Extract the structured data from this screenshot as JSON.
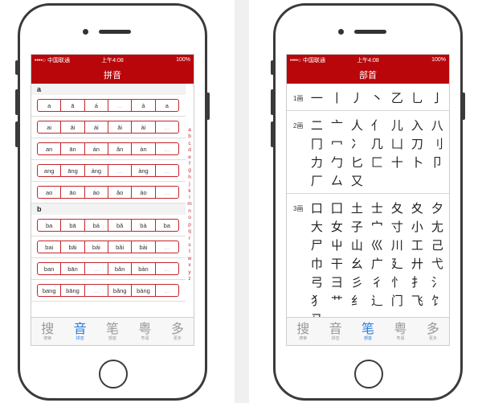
{
  "status": {
    "carrier": "••••○ 中国联通",
    "wifi": "📶",
    "time": "上午4:08",
    "battery": "100%"
  },
  "pinyin_screen": {
    "title": "拼音",
    "sections": [
      {
        "header": "a",
        "rows": [
          [
            "a",
            "ā",
            "á",
            "…",
            "à",
            "a"
          ],
          [
            "ai",
            "āi",
            "ái",
            "ǎi",
            "ài",
            "…"
          ],
          [
            "an",
            "ān",
            "án",
            "ǎn",
            "àn",
            "…"
          ],
          [
            "ang",
            "āng",
            "áng",
            "…",
            "àng",
            "…"
          ],
          [
            "ao",
            "āo",
            "áo",
            "ǎo",
            "ào",
            "…"
          ]
        ]
      },
      {
        "header": "b",
        "rows": [
          [
            "ba",
            "bā",
            "bá",
            "bǎ",
            "bà",
            "ba"
          ],
          [
            "bai",
            "bāi",
            "bái",
            "bǎi",
            "bài",
            "…"
          ],
          [
            "ban",
            "bān",
            "…",
            "bǎn",
            "bàn",
            "…"
          ],
          [
            "bang",
            "bāng",
            "…",
            "bǎng",
            "bàng",
            "…"
          ]
        ]
      }
    ],
    "index": [
      "a",
      "b",
      "c",
      "d",
      "e",
      "f",
      "g",
      "h",
      "j",
      "k",
      "l",
      "m",
      "n",
      "o",
      "p",
      "q",
      "r",
      "s",
      "t",
      "w",
      "x",
      "y",
      "z"
    ]
  },
  "radical_screen": {
    "title": "部首",
    "groups": [
      {
        "label": "1画",
        "radicals": [
          "一",
          "丨",
          "丿",
          "丶",
          "乙",
          "乚",
          "亅"
        ]
      },
      {
        "label": "2画",
        "radicals": [
          "二",
          "亠",
          "人",
          "亻",
          "儿",
          "入",
          "八",
          "冂",
          "冖",
          "冫",
          "几",
          "凵",
          "刀",
          "刂",
          "力",
          "勹",
          "匕",
          "匚",
          "十",
          "卜",
          "卩",
          "厂",
          "厶",
          "又"
        ]
      },
      {
        "label": "3画",
        "radicals": [
          "口",
          "囗",
          "土",
          "士",
          "夂",
          "夊",
          "夕",
          "大",
          "女",
          "子",
          "宀",
          "寸",
          "小",
          "尢",
          "尸",
          "屮",
          "山",
          "巛",
          "川",
          "工",
          "己",
          "巾",
          "干",
          "幺",
          "广",
          "廴",
          "廾",
          "弋",
          "弓",
          "彐",
          "彡",
          "彳",
          "忄",
          "扌",
          "氵",
          "犭",
          "艹",
          "纟",
          "辶",
          "门",
          "飞",
          "饣",
          "马"
        ]
      }
    ]
  },
  "tabs": [
    {
      "glyph": "搜",
      "label": "搜索"
    },
    {
      "glyph": "音",
      "label": "拼音"
    },
    {
      "glyph": "笔",
      "label": "部首"
    },
    {
      "glyph": "粤",
      "label": "粤语"
    },
    {
      "glyph": "多",
      "label": "更多"
    }
  ],
  "colors": {
    "brand_red": "#b8060b",
    "active_tab": "#2a7de0"
  }
}
